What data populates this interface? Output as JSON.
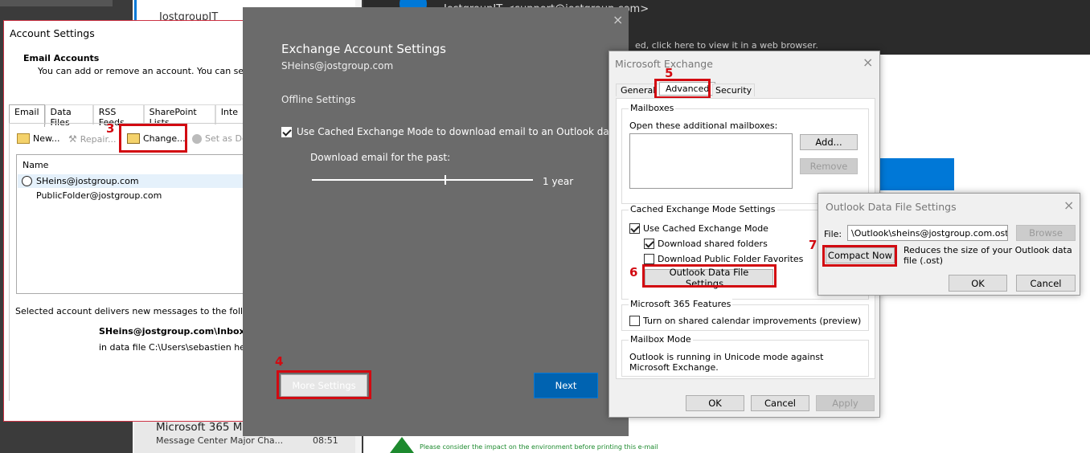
{
  "background": {
    "sender_partial": "JostgroupIT <support@jostgroup.com>",
    "banner_text": "ed, click here to view it in a web browser.",
    "list_item_title": "Microsoft 365 M",
    "list_item_subject": "Message Center Major Cha...",
    "list_item_time": "08:51",
    "list_top_partial": "JostgroupIT",
    "footer_text": "Please consider the impact on the environment before printing this e-mail"
  },
  "account_settings": {
    "title": "Account Settings",
    "heading": "Email Accounts",
    "description": "You can add or remove an account. You can select",
    "tabs": [
      "Email",
      "Data Files",
      "RSS Feeds",
      "SharePoint Lists",
      "Inte"
    ],
    "toolbar": {
      "new": "New...",
      "repair": "Repair...",
      "change": "Change...",
      "set_default": "Set as De"
    },
    "column_name": "Name",
    "accounts": [
      "SHeins@jostgroup.com",
      "PublicFolder@jostgroup.com"
    ],
    "delivers_label": "Selected account delivers new messages to the followin",
    "inbox_path": "SHeins@jostgroup.com\\Inbox",
    "data_file": "in data file C:\\Users\\sebastien hein"
  },
  "exchange_account": {
    "title": "Exchange Account Settings",
    "email": "SHeins@jostgroup.com",
    "section": "Offline Settings",
    "cached_mode_label": "Use Cached Exchange Mode to download email to an Outlook data file",
    "cached_mode_checked": true,
    "download_label": "Download email for the past:",
    "download_value": "1 year",
    "slider_position": 0.6,
    "more_settings": "More Settings",
    "next": "Next",
    "close": "×"
  },
  "ms_exchange": {
    "title": "Microsoft Exchange",
    "tabs": [
      "General",
      "Advanced",
      "Security"
    ],
    "active_tab": "Advanced",
    "mailboxes_group": "Mailboxes",
    "open_additional": "Open these additional mailboxes:",
    "add": "Add...",
    "remove": "Remove",
    "cached_group": "Cached Exchange Mode Settings",
    "use_cached": "Use Cached Exchange Mode",
    "download_shared": "Download shared folders",
    "download_public": "Download Public Folder Favorites",
    "data_file_settings": "Outlook Data File Settings...",
    "m365_group": "Microsoft 365 Features",
    "shared_calendar": "Turn on shared calendar improvements (preview)",
    "mailbox_mode_group": "Mailbox Mode",
    "mailbox_mode_text": "Outlook is running in Unicode mode against Microsoft Exchange.",
    "ok": "OK",
    "cancel": "Cancel",
    "apply": "Apply",
    "close": "×"
  },
  "data_file_dialog": {
    "title": "Outlook Data File Settings",
    "file_label": "File:",
    "file_value": "\\Outlook\\sheins@jostgroup.com.ost",
    "browse": "Browse",
    "compact_now": "Compact Now",
    "compact_desc": "Reduces the size of your Outlook data file (.ost)",
    "ok": "OK",
    "cancel": "Cancel",
    "close": "×"
  },
  "steps": [
    "3",
    "4",
    "5",
    "6",
    "7"
  ],
  "colors": {
    "highlight": "#d20a11",
    "primary_blue": "#0063b1",
    "dark_panel": "#6b6b6b"
  }
}
